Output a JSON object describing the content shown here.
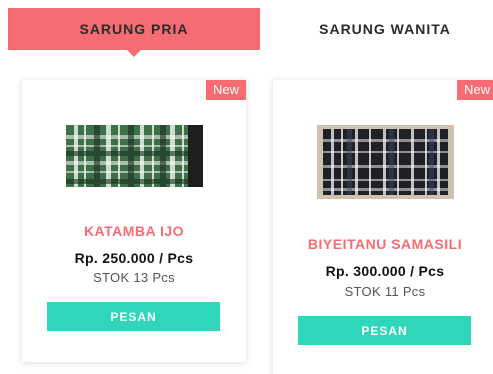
{
  "tabs": [
    {
      "label": "SARUNG PRIA",
      "active": true
    },
    {
      "label": "SARUNG WANITA",
      "active": false
    }
  ],
  "products": [
    {
      "badge": "New",
      "image_alt": "green plaid sarung",
      "name": "KATAMBA IJO",
      "price": "Rp. 250.000 / Pcs",
      "stock": "STOK 13 Pcs",
      "button": "PESAN"
    },
    {
      "badge": "New",
      "image_alt": "black and white plaid sarung",
      "name": "BIYEITANU SAMASILI",
      "price": "Rp. 300.000 / Pcs",
      "stock": "STOK 11 Pcs",
      "button": "PESAN"
    }
  ],
  "colors": {
    "accent": "#f76b72",
    "button": "#2fd6ba",
    "text": "#111111"
  }
}
